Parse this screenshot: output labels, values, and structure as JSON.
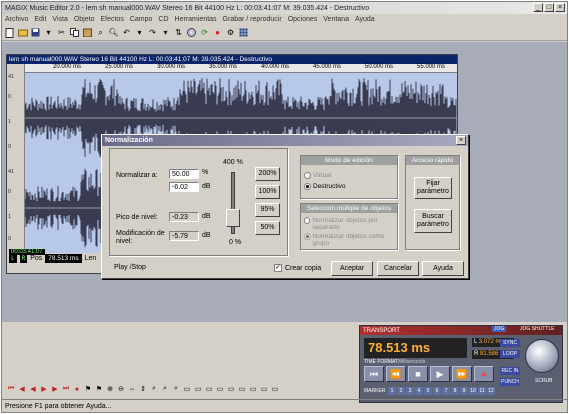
{
  "app": {
    "title": "MAGIX Music Editor 2.0 - lem sh manual000.WAV Stereo 16 Bit 44100 Hz L: 00:03:41:07 M: 39.035.424 - Destructivo",
    "window_buttons": [
      "_",
      "□",
      "×"
    ]
  },
  "menu": [
    "Archivo",
    "Edit",
    "Vista",
    "Objeto",
    "Efectos",
    "Campo",
    "CD",
    "Herramientas",
    "Grabar / reproducir",
    "Opciones",
    "Ventana",
    "Ayuda"
  ],
  "wave_window": {
    "title": "lem sh manual000.WAV  Stereo 16 Bit 44100 Hz L: 00:03:41:07 M: 39.035.424 - Destructivo",
    "ruler_ticks": [
      "20.000 ms",
      "25.000 ms",
      "30.000 ms",
      "35.000 ms",
      "40.000 ms",
      "45.000 ms",
      "50.000 ms",
      "55.000 ms"
    ],
    "left_labels": [
      "41",
      "0",
      "1",
      "0",
      "41",
      "0",
      "1",
      "0"
    ],
    "pos_label": "Pos",
    "pos_value": "78.513 ms",
    "len_label": "Len",
    "timecode": "00:03:41:07",
    "lr": [
      "L",
      "R"
    ]
  },
  "dialog": {
    "title": "Normalización",
    "close": "×",
    "normalize_label": "Normalizar a:",
    "normalize_pct": "50.00",
    "normalize_pct_unit": "%",
    "normalize_db": "-6.02",
    "normalize_db_unit": "dB",
    "peak_label": "Pico de nivel:",
    "peak_value": "-0.23",
    "peak_unit": "dB",
    "mod_label": "Modificación de nivel:",
    "mod_value": "-5.79",
    "mod_unit": "dB",
    "slider_top": "400 %",
    "slider_bottom": "0 %",
    "preset_buttons": [
      "200%",
      "100%",
      "95%",
      "50%"
    ],
    "mode_group": "Modo de edición",
    "mode_virtual": "Virtual",
    "mode_destructive": "Destructivo",
    "multi_group": "Selección múltiple de objetos",
    "multi_opt1": "Normalizar objetos por separado",
    "multi_opt2": "Normalizar objetos como grupo",
    "quick_group": "Acceso rápido",
    "fix_param": "Fijar parámetro",
    "find_param": "Buscar parámetro",
    "play_stop": "Play /Stop",
    "create_copy": "Crear copia",
    "accept": "Aceptar",
    "cancel": "Cancelar",
    "help": "Ayuda"
  },
  "transport": {
    "title": "TRANSPORT",
    "jog_shuttle": "JOG SHUTTLE",
    "time": "78.513 ms",
    "time_format": "TIME FORMAT",
    "time_format_value": "Milliseconds",
    "l_value": "3.072 ms",
    "r_value": "81.586 ms",
    "sync": "SYNC",
    "loop": "LOOP",
    "rec_in": "REC IN",
    "punch": "PUNCH",
    "marker": "MARKER",
    "scrub": "SCRUB",
    "marker_numbers": [
      "1",
      "2",
      "3",
      "4",
      "5",
      "6",
      "7",
      "8",
      "9",
      "10",
      "11",
      "12"
    ]
  },
  "status": {
    "text": "Presione F1 para obtener Ayuda..."
  }
}
